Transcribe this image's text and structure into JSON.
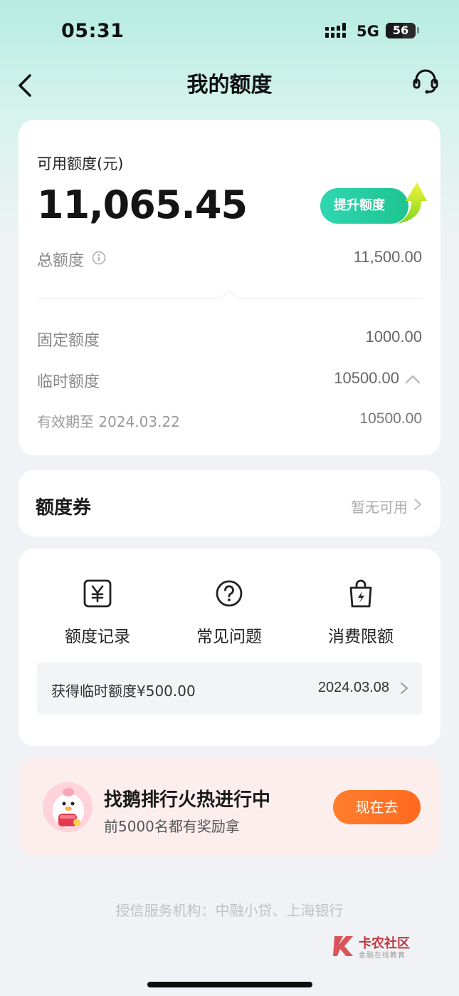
{
  "status_bar": {
    "time": "05:31",
    "network": "5G",
    "battery": "56",
    "battery_level": 0.56
  },
  "nav": {
    "title": "我的额度",
    "back_icon": "chevron-left-icon",
    "service_icon": "headset-icon"
  },
  "credit": {
    "available_label": "可用额度(元)",
    "available_amount": "11,065.45",
    "raise_button": "提升额度",
    "total_label": "总额度",
    "total_value": "11,500.00",
    "fixed_label": "固定额度",
    "fixed_value": "1000.00",
    "temp_label": "临时额度",
    "temp_value": "10500.00",
    "valid_label": "有效期至 2024.03.22",
    "valid_value": "10500.00"
  },
  "coupon": {
    "title": "额度券",
    "status": "暂无可用"
  },
  "tools": [
    {
      "label": "额度记录",
      "icon": "yen-icon"
    },
    {
      "label": "常见问题",
      "icon": "question-icon"
    },
    {
      "label": "消费限额",
      "icon": "bag-bolt-icon"
    }
  ],
  "record": {
    "text": "获得临时额度¥500.00",
    "date": "2024.03.08"
  },
  "promo": {
    "title": "找鹅排行火热进行中",
    "subtitle": "前5000名都有奖励拿",
    "button": "现在去"
  },
  "footer": {
    "note": "授信服务机构：中融小贷、上海银行"
  },
  "watermark": {
    "name": "卡农社区",
    "sub": "金融在线教育"
  },
  "colors": {
    "accent_green": "#1ec48f",
    "accent_orange": "#ff6a1f",
    "promo_bg": "#fdeeee"
  }
}
